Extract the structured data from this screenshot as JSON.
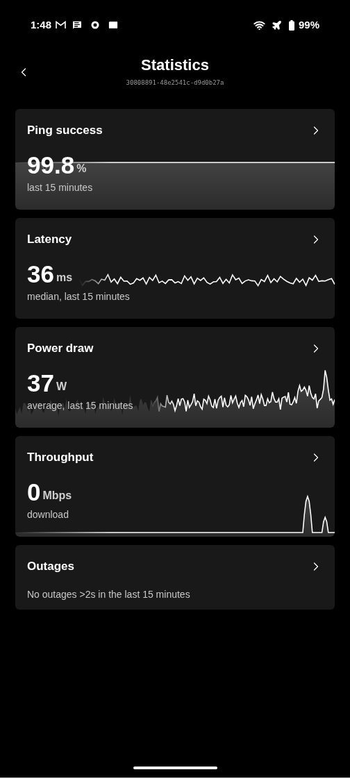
{
  "status_bar": {
    "time": "1:48",
    "battery": "99%"
  },
  "header": {
    "title": "Statistics",
    "subtitle": "30808891-48e2541c-d9d0b27a"
  },
  "cards": [
    {
      "kind": "metric",
      "title": "Ping success",
      "value": "99.8",
      "unit": "%",
      "caption": "last 15 minutes"
    },
    {
      "kind": "metric",
      "title": "Latency",
      "value": "36",
      "unit": "ms",
      "caption": "median, last 15 minutes"
    },
    {
      "kind": "metric",
      "title": "Power draw",
      "value": "37",
      "unit": "W",
      "caption": "average, last 15 minutes"
    },
    {
      "kind": "metric",
      "title": "Throughput",
      "value": "0",
      "unit": "Mbps",
      "caption": "download"
    },
    {
      "kind": "text",
      "title": "Outages",
      "caption": "No outages >2s in the last 15 minutes"
    }
  ]
}
